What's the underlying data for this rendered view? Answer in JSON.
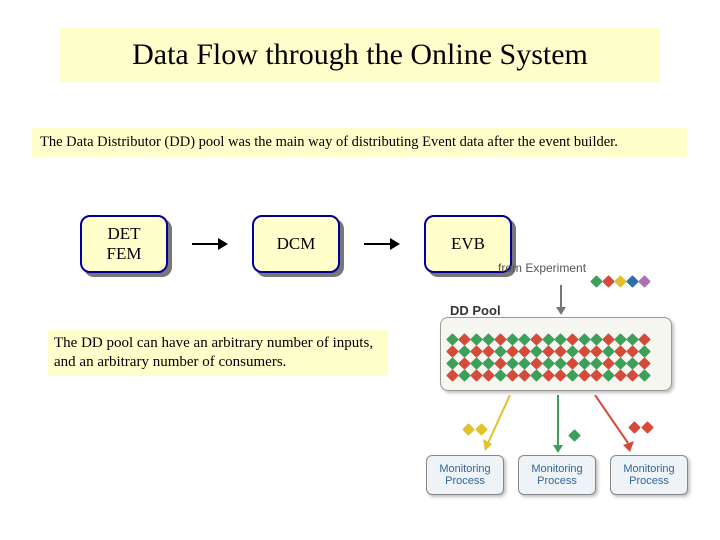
{
  "title": "Data Flow through the Online System",
  "subtitle": "The Data Distributor (DD) pool was the main way of distributing Event data after the event builder.",
  "flow": {
    "node1_line1": "DET",
    "node1_line2": "FEM",
    "node2": "DCM",
    "node3": "EVB"
  },
  "caption": "The DD pool can have an arbitrary number of inputs, and an arbitrary number of consumers.",
  "diagram": {
    "from_experiment": "from Experiment",
    "pool_label": "DD Pool",
    "consumer_line1": "Monitoring",
    "consumer_line2": "Process",
    "colors": {
      "c1": "#3aa05a",
      "c2": "#2f6fb0",
      "c3": "#e0c22a",
      "c4": "#d64a3a",
      "c5": "#b070b0",
      "c6": "#50a8a0"
    }
  }
}
